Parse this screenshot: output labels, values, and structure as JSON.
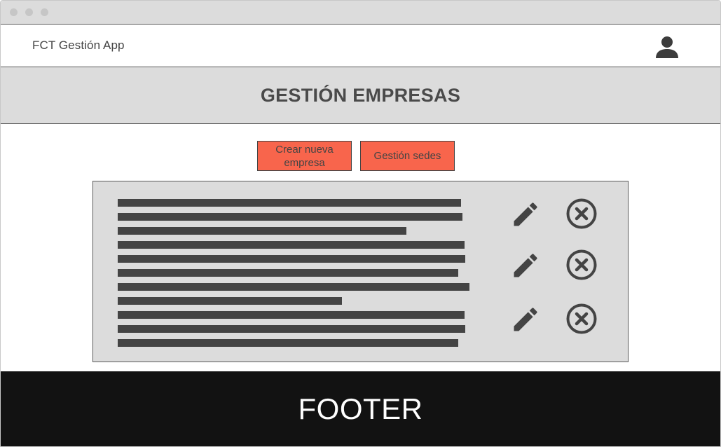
{
  "app": {
    "title": "FCT Gestión App"
  },
  "page": {
    "title": "GESTIÓN EMPRESAS"
  },
  "actions": {
    "create_label": "Crear nueva empresa",
    "sedes_label": "Gestión sedes"
  },
  "list": {
    "rows": 3,
    "row_actions": [
      "pencil-icon",
      "circle-x-icon"
    ]
  },
  "footer": {
    "text": "FOOTER"
  },
  "icons": {
    "user": "user-icon",
    "edit": "pencil-icon",
    "delete": "circle-x-icon"
  },
  "colors": {
    "button": "#f8654c",
    "panel": "#dcdcdc",
    "text_dark": "#444444",
    "footer": "#121212"
  }
}
